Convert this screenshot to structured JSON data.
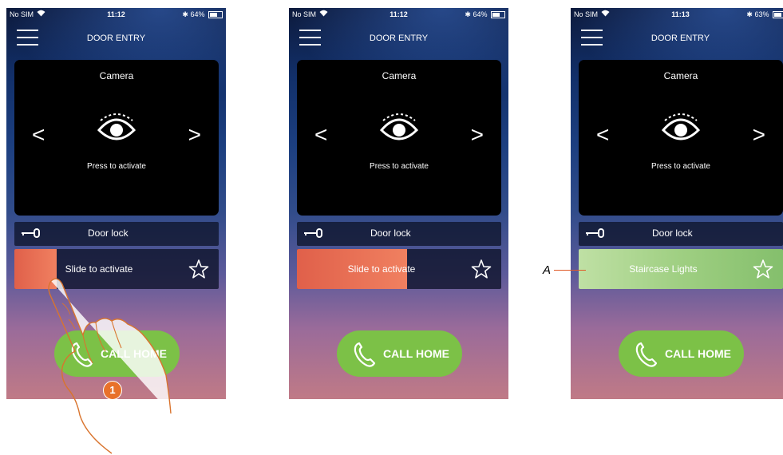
{
  "screens": [
    {
      "status": {
        "carrier": "No SIM",
        "time": "11:12",
        "battery": "64%",
        "battery_level": 0.64
      },
      "title": "DOOR ENTRY",
      "camera": {
        "title": "Camera",
        "hint": "Press to activate",
        "prev": "<",
        "next": ">"
      },
      "lock": {
        "label": "Door lock"
      },
      "slider": {
        "label": "Slide to activate",
        "progress": 0.21
      },
      "call": {
        "label": "CALL HOME"
      }
    },
    {
      "status": {
        "carrier": "No SIM",
        "time": "11:12",
        "battery": "64%",
        "battery_level": 0.64
      },
      "title": "DOOR ENTRY",
      "camera": {
        "title": "Camera",
        "hint": "Press to activate",
        "prev": "<",
        "next": ">"
      },
      "lock": {
        "label": "Door lock"
      },
      "slider": {
        "label": "Slide to activate",
        "progress": 0.54
      },
      "call": {
        "label": "CALL HOME"
      }
    },
    {
      "status": {
        "carrier": "No SIM",
        "time": "11:13",
        "battery": "63%",
        "battery_level": 0.63
      },
      "title": "DOOR ENTRY",
      "camera": {
        "title": "Camera",
        "hint": "Press to activate",
        "prev": "<",
        "next": ">"
      },
      "lock": {
        "label": "Door lock"
      },
      "slider": {
        "label": "Staircase Lights",
        "progress": 1.0
      },
      "call": {
        "label": "CALL HOME"
      }
    }
  ],
  "annotations": {
    "marker_label": "A",
    "step_number": "1"
  },
  "colors": {
    "slider_handle": "#e8674f",
    "lights_active": "#a9d38d",
    "call_button": "#7cc147",
    "step_badge": "#e8712a"
  },
  "icons": [
    "wifi-icon",
    "bluetooth-icon",
    "battery-icon",
    "menu-icon",
    "eye-icon",
    "chevron-left-icon",
    "chevron-right-icon",
    "key-icon",
    "star-icon",
    "phone-icon",
    "hand-pointer-icon"
  ]
}
